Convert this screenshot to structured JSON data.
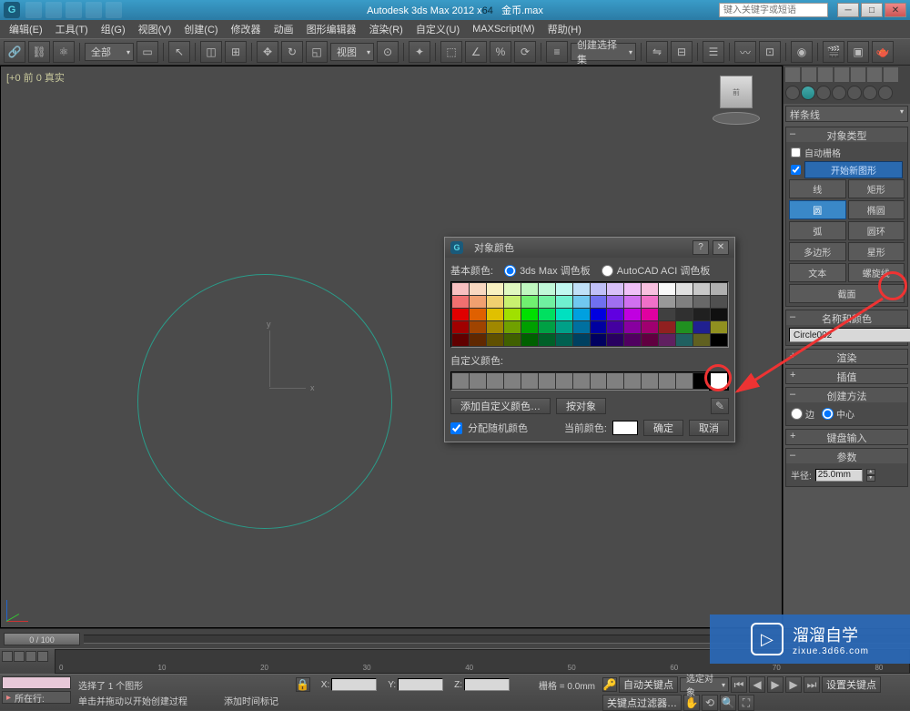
{
  "title_prefix": "Autodesk 3ds Max  2012 x",
  "title_file": "金币.max",
  "search_placeholder": "键入关键字或短语",
  "menu": [
    "编辑(E)",
    "工具(T)",
    "组(G)",
    "视图(V)",
    "创建(C)",
    "修改器",
    "动画",
    "图形编辑器",
    "渲染(R)",
    "自定义(U)",
    "MAXScript(M)",
    "帮助(H)"
  ],
  "toolbar": {
    "selection_set": "全部",
    "view_label": "视图",
    "snap_label": "创建选择集"
  },
  "viewport_label": "[+0 前 0 真实",
  "gizmo_x": "x",
  "gizmo_y": "y",
  "cmd_panel": {
    "category": "样条线",
    "rollout_object_type": "对象类型",
    "auto_grid": "自动栅格",
    "start_new": "开始新图形",
    "buttons": [
      {
        "label": "线",
        "active": false
      },
      {
        "label": "矩形",
        "active": false
      },
      {
        "label": "圆",
        "active": true
      },
      {
        "label": "椭圆",
        "active": false
      },
      {
        "label": "弧",
        "active": false
      },
      {
        "label": "圆环",
        "active": false
      },
      {
        "label": "多边形",
        "active": false
      },
      {
        "label": "星形",
        "active": false
      },
      {
        "label": "文本",
        "active": false
      },
      {
        "label": "螺旋线",
        "active": false
      },
      {
        "label": "截面",
        "active": false
      }
    ],
    "name_color": "名称和颜色",
    "object_name": "Circle002",
    "render": "渲染",
    "interp": "插值",
    "creation_method": "创建方法",
    "radio_edge": "边",
    "radio_center": "中心",
    "keyboard_entry": "键盘输入",
    "params": "参数",
    "radius_label": "半径:",
    "radius_value": "25.0mm"
  },
  "dialog": {
    "title": "对象颜色",
    "basic_colors": "基本颜色:",
    "palette_3dsmax": "3ds Max 调色板",
    "palette_autocad": "AutoCAD ACI 调色板",
    "custom_colors": "自定义颜色:",
    "add_custom": "添加自定义颜色…",
    "by_object": "按对象",
    "random": "分配随机颜色",
    "current": "当前颜色:",
    "ok": "确定",
    "cancel": "取消"
  },
  "timeline": {
    "slider": "0 / 100"
  },
  "status": {
    "line_label": "所在行:",
    "prompt1": "选择了 1 个图形",
    "prompt2": "单击并拖动以开始创建过程",
    "add_time": "添加时间标记",
    "grid": "栅格 = 0.0mm",
    "auto_key": "自动关键点",
    "sel_obj": "选定对象",
    "set_key": "设置关键点",
    "key_filter": "关键点过滤器…"
  },
  "watermark": {
    "brand": "溜溜自学",
    "sub": "zixue.3d66.com"
  },
  "palette_colors": [
    "#F8C0C0",
    "#F8D8C0",
    "#F8F0C0",
    "#E0F8C0",
    "#C0F8C0",
    "#C0F8D8",
    "#C0F8F0",
    "#C0E0F8",
    "#C0C0F8",
    "#D8C0F8",
    "#F0C0F8",
    "#F8C0E0",
    "#F8F8F8",
    "#E0E0E0",
    "#C8C8C8",
    "#B0B0B0",
    "#F07070",
    "#F0A070",
    "#F0D070",
    "#C8F070",
    "#70F070",
    "#70F0A0",
    "#70F0D0",
    "#70C8F0",
    "#7070F0",
    "#A070F0",
    "#D070F0",
    "#F070C8",
    "#989898",
    "#808080",
    "#686868",
    "#505050",
    "#E00000",
    "#E06000",
    "#E0C000",
    "#A0E000",
    "#00E000",
    "#00E060",
    "#00E0C0",
    "#00A0E0",
    "#0000E0",
    "#6000E0",
    "#C000E0",
    "#E000A0",
    "#404040",
    "#303030",
    "#202020",
    "#101010",
    "#A00000",
    "#A04400",
    "#A08800",
    "#70A000",
    "#00A000",
    "#00A044",
    "#00A088",
    "#0070A0",
    "#0000A0",
    "#4400A0",
    "#8800A0",
    "#A00070",
    "#902020",
    "#209020",
    "#202090",
    "#909020",
    "#600000",
    "#602800",
    "#605000",
    "#406000",
    "#006000",
    "#006028",
    "#006050",
    "#004060",
    "#000060",
    "#280060",
    "#500060",
    "#600040",
    "#602060",
    "#206060",
    "#606020",
    "#000000"
  ]
}
